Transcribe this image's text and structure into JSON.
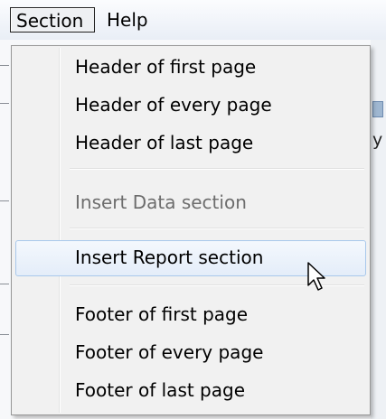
{
  "menubar": {
    "items": [
      {
        "label": "Section"
      },
      {
        "label": "Help"
      }
    ]
  },
  "background": {
    "edge_text": "y"
  },
  "section_menu": {
    "items": [
      {
        "label": "Header of first page",
        "enabled": true
      },
      {
        "label": "Header of every page",
        "enabled": true
      },
      {
        "label": "Header of last page",
        "enabled": true
      },
      {
        "label": "Insert Data section",
        "enabled": false
      },
      {
        "label": "Insert Report section",
        "enabled": true,
        "highlighted": true
      },
      {
        "label": "Footer of first page",
        "enabled": true
      },
      {
        "label": "Footer of every page",
        "enabled": true
      },
      {
        "label": "Footer of last page",
        "enabled": true
      }
    ]
  },
  "colors": {
    "highlight_border": "#a8c8eb",
    "disabled_text": "#6d6d6d",
    "menu_background": "#f1f1f1"
  }
}
